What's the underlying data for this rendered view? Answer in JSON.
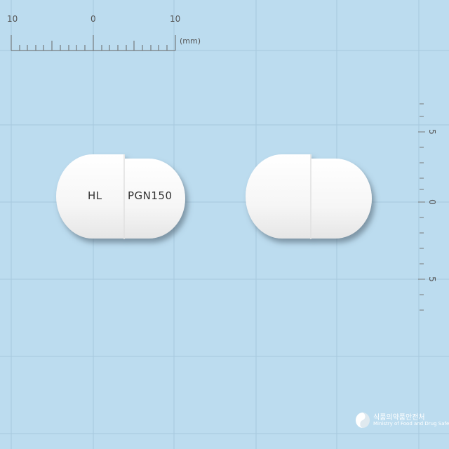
{
  "ruler": {
    "top_labels": [
      "10",
      "0",
      "10"
    ],
    "unit": "(mm)",
    "side_labels": [
      "5",
      "0",
      "5"
    ]
  },
  "capsule_front": {
    "imprint_left": "HL",
    "imprint_right": "PGN150"
  },
  "logo": {
    "korean": "식품의약품안전처",
    "english": "Ministry of Food and Drug Safety"
  },
  "colors": {
    "background": "#bcdcef",
    "grid": "#a6c8dd",
    "capsule": "#f7f7f7"
  }
}
